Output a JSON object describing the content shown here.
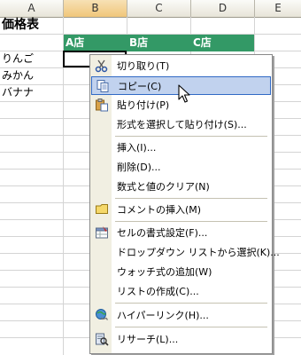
{
  "columns": [
    "A",
    "B",
    "C",
    "D",
    "E"
  ],
  "sheet": {
    "title": "価格表",
    "headers": [
      "A店",
      "B店",
      "C店"
    ],
    "rows": [
      "りんご",
      "みかん",
      "バナナ"
    ]
  },
  "context_menu": {
    "items": [
      {
        "label": "切り取り(T)",
        "icon": "scissors-icon"
      },
      {
        "label": "コピー(C)",
        "icon": "copy-icon",
        "highlighted": true
      },
      {
        "label": "貼り付け(P)",
        "icon": "paste-icon"
      },
      {
        "label": "形式を選択して貼り付け(S)...",
        "icon": ""
      },
      {
        "label": "挿入(I)...",
        "icon": ""
      },
      {
        "label": "削除(D)...",
        "icon": ""
      },
      {
        "label": "数式と値のクリア(N)",
        "icon": ""
      },
      {
        "label": "コメントの挿入(M)",
        "icon": "comment-icon"
      },
      {
        "label": "セルの書式設定(F)...",
        "icon": "format-cells-icon"
      },
      {
        "label": "ドロップダウン リストから選択(K)...",
        "icon": ""
      },
      {
        "label": "ウォッチ式の追加(W)",
        "icon": ""
      },
      {
        "label": "リストの作成(C)...",
        "icon": ""
      },
      {
        "label": "ハイパーリンク(H)...",
        "icon": "hyperlink-icon"
      },
      {
        "label": "リサーチ(L)...",
        "icon": "research-icon"
      }
    ]
  },
  "colors": {
    "header_band": "#339966",
    "menu_highlight": "#c1d2ee",
    "menu_highlight_border": "#316ac5"
  }
}
